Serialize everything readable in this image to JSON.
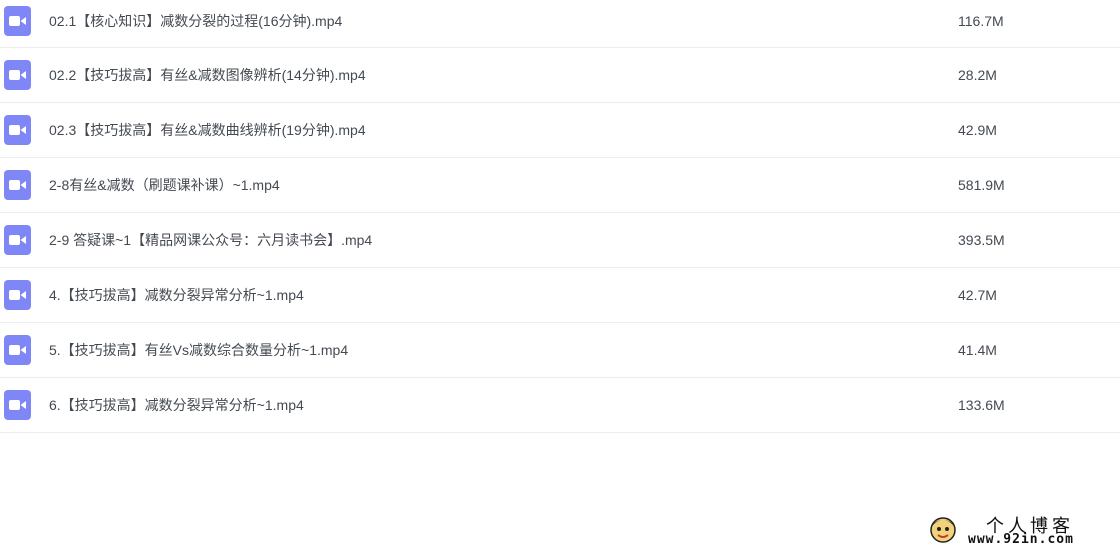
{
  "files": [
    {
      "icon": "video-file-icon",
      "name": "02.1【核心知识】减数分裂的过程(16分钟).mp4",
      "size": "116.7M"
    },
    {
      "icon": "video-file-icon",
      "name": "02.2【技巧拔高】有丝&减数图像辨析(14分钟).mp4",
      "size": "28.2M"
    },
    {
      "icon": "video-file-icon",
      "name": "02.3【技巧拔高】有丝&减数曲线辨析(19分钟).mp4",
      "size": "42.9M"
    },
    {
      "icon": "video-file-icon",
      "name": "2-8有丝&减数（刷题课补课）~1.mp4",
      "size": "581.9M"
    },
    {
      "icon": "video-file-icon",
      "name": "2-9 答疑课~1【精品网课公众号：六月读书会】.mp4",
      "size": "393.5M"
    },
    {
      "icon": "video-file-icon",
      "name": "4.【技巧拔高】减数分裂异常分析~1.mp4",
      "size": "42.7M"
    },
    {
      "icon": "video-file-icon",
      "name": "5.【技巧拔高】有丝Vs减数综合数量分析~1.mp4",
      "size": "41.4M"
    },
    {
      "icon": "video-file-icon",
      "name": "6.【技巧拔高】减数分裂异常分析~1.mp4",
      "size": "133.6M"
    }
  ],
  "watermark": {
    "title": "个人博客",
    "url": "www.92in.com"
  },
  "colors": {
    "icon_bg": "#7f86f5",
    "text": "#444a52",
    "divider": "#ececf0"
  }
}
